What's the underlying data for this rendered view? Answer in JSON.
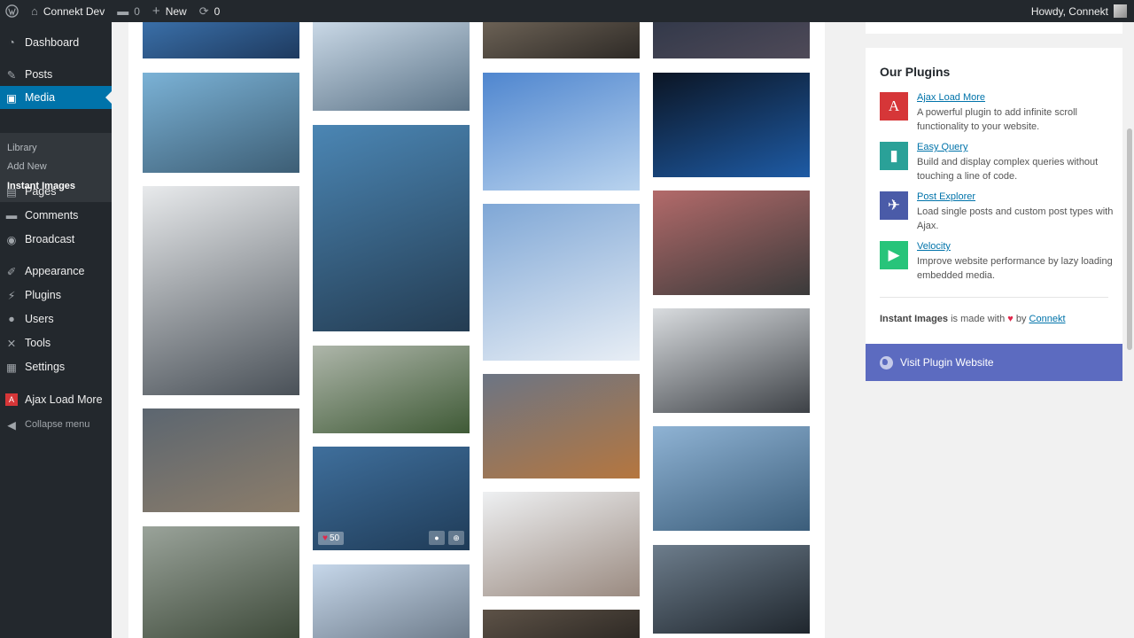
{
  "adminbar": {
    "site_name": "Connekt Dev",
    "comments_count": "0",
    "new_label": "New",
    "updates_count": "0",
    "howdy": "Howdy, Connekt"
  },
  "sidebar": {
    "items": [
      {
        "label": "Dashboard",
        "icon": "dashboard-icon"
      },
      {
        "label": "Posts",
        "icon": "pin-icon"
      },
      {
        "label": "Media",
        "icon": "media-icon"
      },
      {
        "label": "Pages",
        "icon": "page-icon"
      },
      {
        "label": "Comments",
        "icon": "comment-icon"
      },
      {
        "label": "Broadcast",
        "icon": "broadcast-icon"
      },
      {
        "label": "Appearance",
        "icon": "brush-icon"
      },
      {
        "label": "Plugins",
        "icon": "plugin-icon"
      },
      {
        "label": "Users",
        "icon": "user-icon"
      },
      {
        "label": "Tools",
        "icon": "wrench-icon"
      },
      {
        "label": "Settings",
        "icon": "settings-icon"
      },
      {
        "label": "Ajax Load More",
        "icon": "ajax-load-more-icon"
      }
    ],
    "submenu": [
      "Library",
      "Add New",
      "Instant Images"
    ],
    "collapse": "Collapse menu"
  },
  "gallery": {
    "photos": [
      {
        "subject": "glass tower",
        "colors": [
          "#3a6fa8",
          "#1e3a5f"
        ]
      },
      {
        "subject": "arch and skyline",
        "colors": [
          "#7bb2d6",
          "#3d5e75"
        ]
      },
      {
        "subject": "foggy skyscrapers",
        "colors": [
          "#e8eaec",
          "#4a5158"
        ]
      },
      {
        "subject": "cn tower rainbow",
        "colors": [
          "#5c6670",
          "#8c7d6a"
        ]
      },
      {
        "subject": "trees and building",
        "colors": [
          "#9aa39a",
          "#3e4a3a"
        ]
      },
      {
        "subject": "ferris wheel",
        "colors": [
          "#c9d8e6",
          "#5b7387"
        ]
      },
      {
        "subject": "toronto sign arch",
        "colors": [
          "#4b86b4",
          "#243c52"
        ]
      },
      {
        "subject": "bushes and wall",
        "colors": [
          "#aeb6aa",
          "#3f5a36"
        ]
      },
      {
        "subject": "curved towers",
        "colors": [
          "#3f6f9c",
          "#1f3b57"
        ]
      },
      {
        "subject": "city hall bottom",
        "colors": [
          "#c6d7ea",
          "#6f7d8c"
        ]
      },
      {
        "subject": "aerial city",
        "colors": [
          "#6b6155",
          "#2e2a26"
        ]
      },
      {
        "subject": "cn tower plane",
        "colors": [
          "#4f86cf",
          "#b9d3ee"
        ]
      },
      {
        "subject": "cn tower clouds",
        "colors": [
          "#7fa7d6",
          "#e8eef5"
        ]
      },
      {
        "subject": "sunset horizon",
        "colors": [
          "#6c7584",
          "#b5763f"
        ]
      },
      {
        "subject": "smiling woman",
        "colors": [
          "#eef0f2",
          "#9a8a80"
        ]
      },
      {
        "subject": "building bottom",
        "colors": [
          "#5d5247",
          "#2f2a25"
        ]
      },
      {
        "subject": "cn tower night",
        "colors": [
          "#33394a",
          "#4f4a58"
        ]
      },
      {
        "subject": "toronto sign night",
        "colors": [
          "#0b1524",
          "#1e5ba5"
        ]
      },
      {
        "subject": "lens in hand",
        "colors": [
          "#b36a6a",
          "#3a3a3a"
        ]
      },
      {
        "subject": "cn tower pod",
        "colors": [
          "#d9dcdf",
          "#3d4146"
        ]
      },
      {
        "subject": "city hall fountain",
        "colors": [
          "#8fb3d4",
          "#3b5d7a"
        ]
      },
      {
        "subject": "glass entrance",
        "colors": [
          "#6d7d8c",
          "#1f262d"
        ]
      }
    ],
    "hover_likes": "50"
  },
  "plugins": {
    "heading": "Our Plugins",
    "items": [
      {
        "name": "Ajax Load More",
        "desc": "A powerful plugin to add infinite scroll functionality to your website.",
        "color": "#d63638",
        "glyph": "A"
      },
      {
        "name": "Easy Query",
        "desc": "Build and display complex queries without touching a line of code.",
        "color": "#2aa198",
        "glyph": "▮"
      },
      {
        "name": "Post Explorer",
        "desc": "Load single posts and custom post types with Ajax.",
        "color": "#4a5ba8",
        "glyph": "✈"
      },
      {
        "name": "Velocity",
        "desc": "Improve website performance by lazy loading embedded media.",
        "color": "#27c47a",
        "glyph": "▶"
      }
    ],
    "made_with_prefix": "Instant Images",
    "made_with_mid": " is made with ",
    "made_with_by": " by ",
    "made_with_link": "Connekt",
    "visit_label": "Visit Plugin Website"
  }
}
